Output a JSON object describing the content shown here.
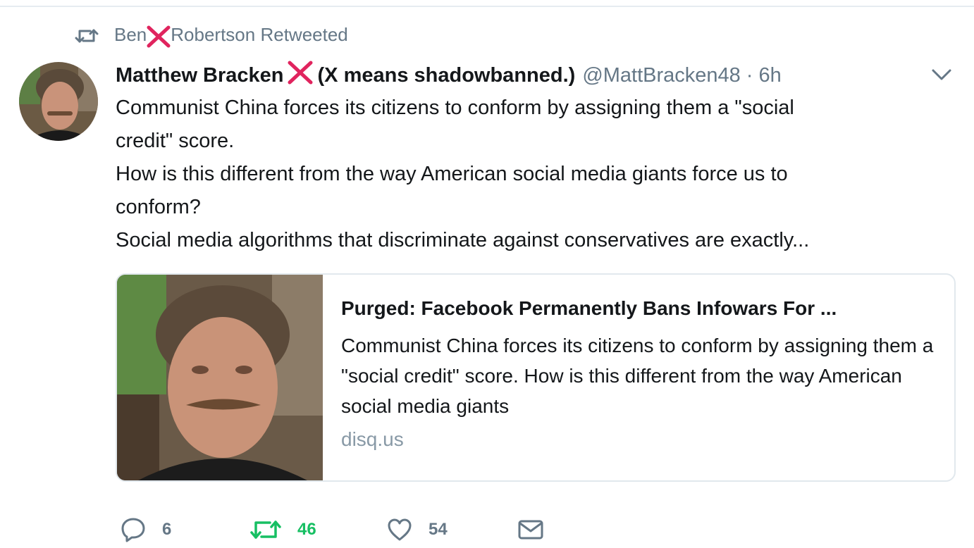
{
  "retweet_context": {
    "name_first": "Ben",
    "name_last": "Robertson",
    "label": "Retweeted"
  },
  "tweet": {
    "author_name": "Matthew Bracken",
    "author_suffix": "(X means shadowbanned.)",
    "handle": "@MattBracken48",
    "separator": "·",
    "time": "6h",
    "text_lines": [
      "Communist China forces its citizens to conform by assigning them a \"social",
      "credit\" score.",
      "How is this different from the way American social media giants force us to",
      "conform?",
      "Social media algorithms that discriminate against conservatives are exactly..."
    ]
  },
  "card": {
    "title": "Purged: Facebook Permanently Bans Infowars For ...",
    "description": "Communist China forces its citizens to conform by assigning them a \"social credit\" score. How is this different from the way American social media giants",
    "domain": "disq.us"
  },
  "actions": {
    "replies": "6",
    "retweets": "46",
    "likes": "54"
  },
  "colors": {
    "secondary_text": "#657786",
    "retweet_active": "#17bf63",
    "x_mark": "#e0245e",
    "card_border": "#e1e8ed"
  },
  "icons": [
    "retweet-icon",
    "x-mark-icon",
    "chevron-down-icon",
    "reply-icon",
    "like-icon",
    "direct-message-icon"
  ]
}
